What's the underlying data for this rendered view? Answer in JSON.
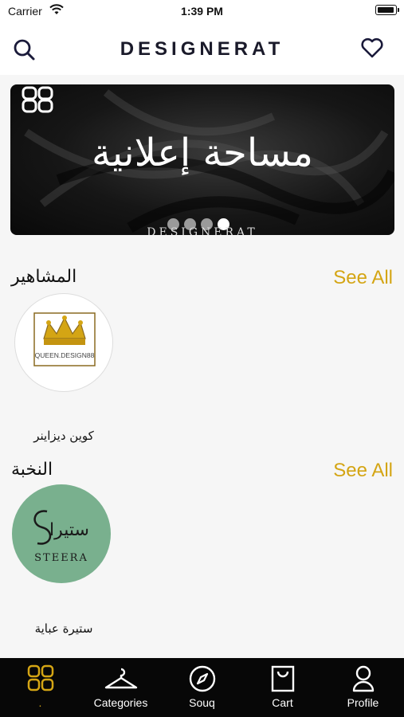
{
  "status_bar": {
    "carrier": "Carrier",
    "time": "1:39 PM"
  },
  "header": {
    "title": "DESIGNERAT",
    "search_icon": "search-icon",
    "favorites_icon": "heart-icon"
  },
  "banner": {
    "headline": "مساحة إعلانية",
    "brand": "DESIGNERAT",
    "slides_total": 4,
    "active_slide": 4
  },
  "sections": [
    {
      "title": "المشاهير",
      "see_all": "See All",
      "items": [
        {
          "name": "كوين ديزاينر",
          "logo_text": "QUEEN.DESIGN88"
        }
      ]
    },
    {
      "title": "النخبة",
      "see_all": "See All",
      "items": [
        {
          "name": "ستيرة عباية",
          "logo_text": "STEERA",
          "logo_script": "ستيرا"
        }
      ]
    }
  ],
  "tab_bar": {
    "items": [
      {
        "label": ".",
        "icon": "brand-logo-icon"
      },
      {
        "label": "Categories",
        "icon": "hanger-icon"
      },
      {
        "label": "Souq",
        "icon": "compass-icon"
      },
      {
        "label": "Cart",
        "icon": "bag-icon"
      },
      {
        "label": "Profile",
        "icon": "person-icon"
      }
    ]
  },
  "colors": {
    "accent": "#d4a514",
    "tab_bar_bg": "#070707",
    "nav_title": "#1a1a2a",
    "steera_bg": "#79b08e"
  }
}
